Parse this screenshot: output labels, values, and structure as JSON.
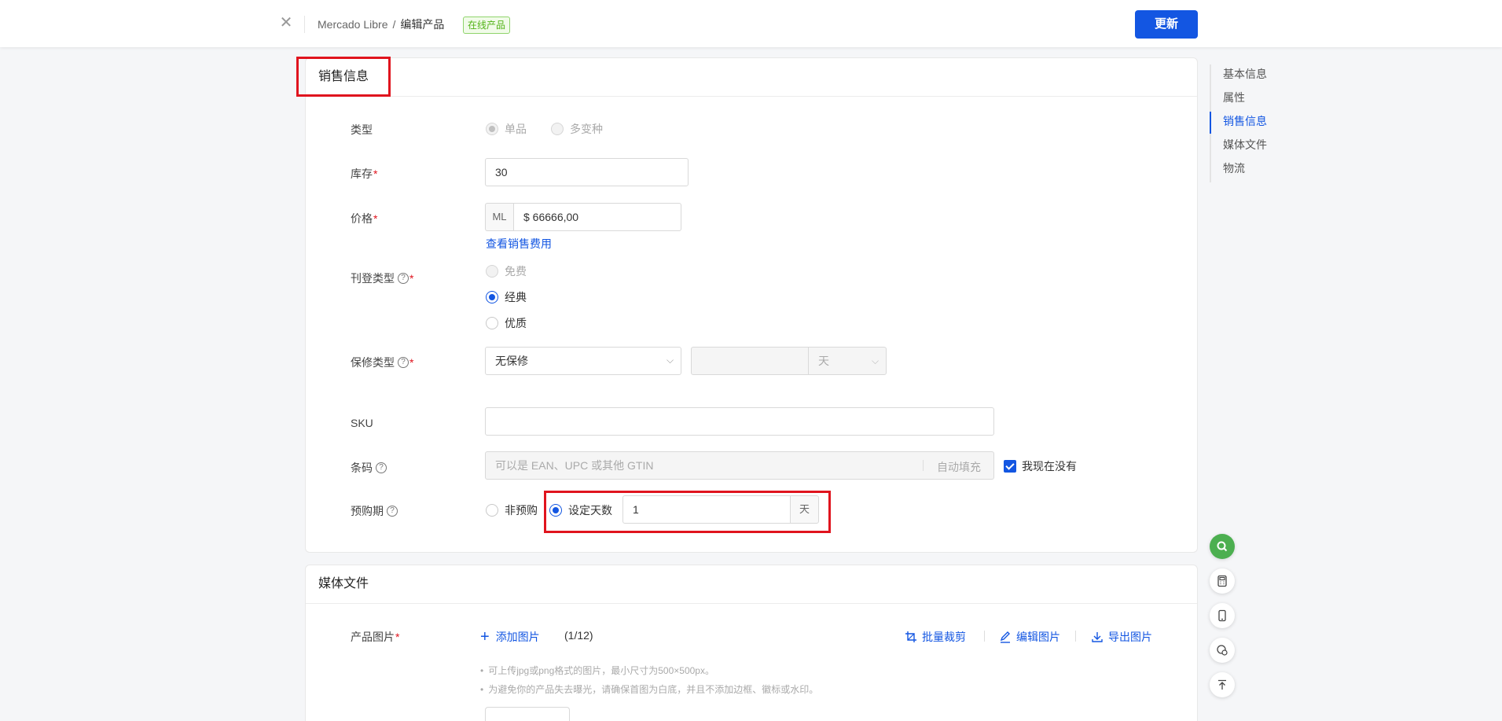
{
  "header": {
    "breadcrumb_root": "Mercado Libre",
    "breadcrumb_sep": "/",
    "breadcrumb_current": "编辑产品",
    "status_tag": "在线产品",
    "update_label": "更新"
  },
  "sales": {
    "title": "销售信息",
    "type": {
      "label": "类型",
      "options": [
        "单品",
        "多变种"
      ],
      "selected": "单品"
    },
    "stock": {
      "label": "库存",
      "value": "30"
    },
    "price": {
      "label": "价格",
      "prefix": "ML",
      "value": "$ 66666,00",
      "fee_link": "查看销售费用"
    },
    "listing_type": {
      "label": "刊登类型",
      "options": [
        "免费",
        "经典",
        "优质"
      ],
      "selected": "经典"
    },
    "warranty": {
      "label": "保修类型",
      "value": "无保修",
      "duration_value": "",
      "unit": "天"
    },
    "sku": {
      "label": "SKU",
      "value": ""
    },
    "barcode": {
      "label": "条码",
      "placeholder": "可以是 EAN、UPC 或其他 GTIN",
      "autofill": "自动填充",
      "none_label": "我现在没有",
      "none_checked": true
    },
    "presale": {
      "label": "预购期",
      "options": [
        "非预购",
        "设定天数"
      ],
      "selected": "设定天数",
      "days": "1",
      "unit": "天"
    }
  },
  "side_nav": {
    "items": [
      "基本信息",
      "属性",
      "销售信息",
      "媒体文件",
      "物流"
    ],
    "active": "销售信息"
  },
  "media": {
    "title": "媒体文件",
    "images_label": "产品图片",
    "add_label": "添加图片",
    "count": "(1/12)",
    "batch_crop": "批量裁剪",
    "edit": "编辑图片",
    "export": "导出图片",
    "tips": [
      "可上传jpg或png格式的图片，最小尺寸为500×500px。",
      "为避免你的产品失去曝光，请确保首图为白底，并且不添加边框、徽标或水印。"
    ]
  },
  "floating": [
    "search-icon",
    "calculator-icon",
    "mobile-icon",
    "chat-icon",
    "back-to-top-icon"
  ],
  "colors": {
    "primary": "#1356e2",
    "highlight": "#e0141e",
    "success": "#52b318",
    "fab_green": "#4caf50"
  }
}
